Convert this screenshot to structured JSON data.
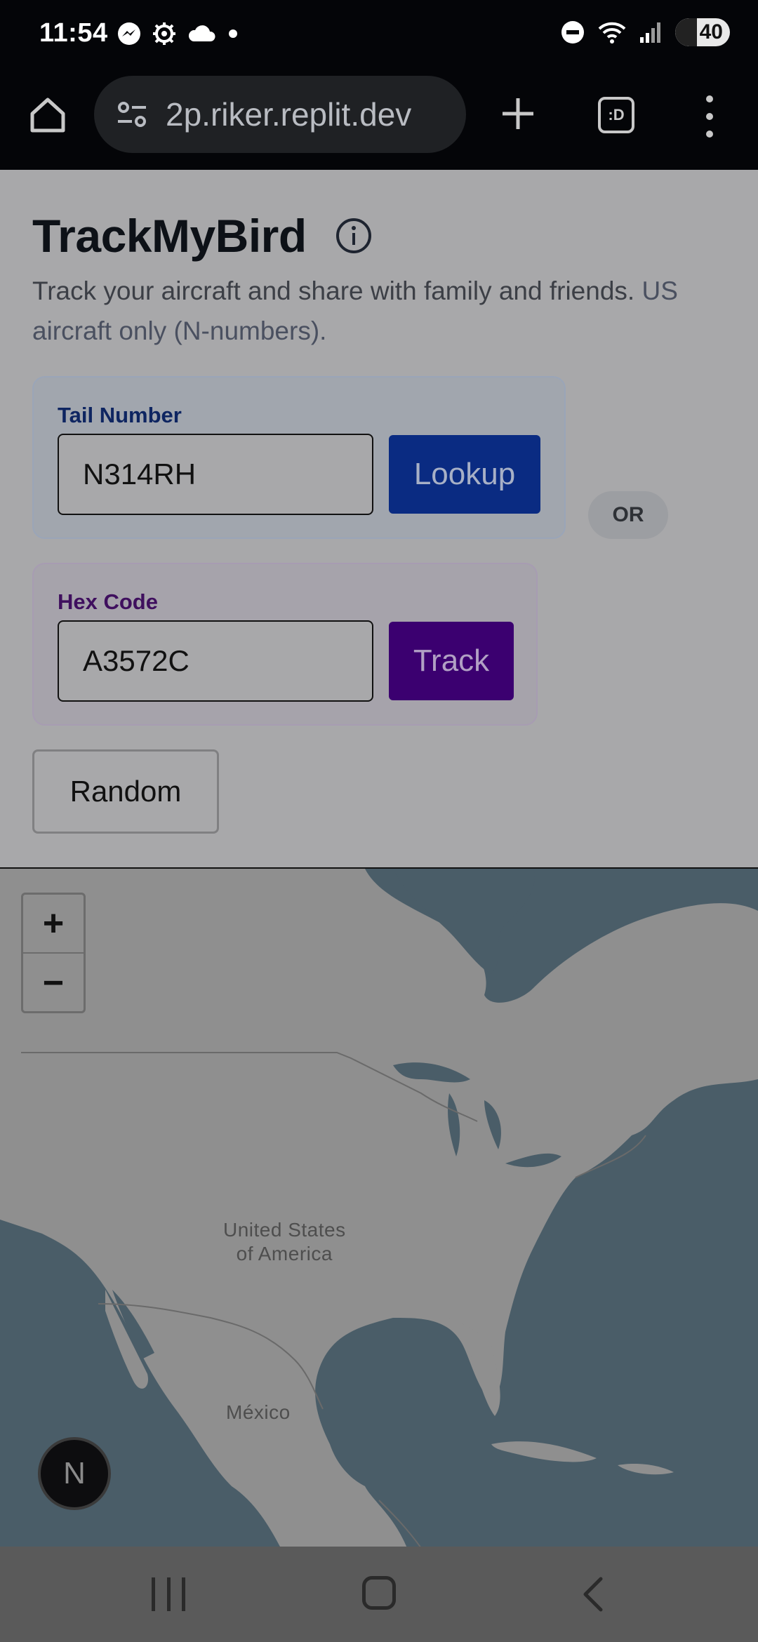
{
  "status_bar": {
    "time": "11:54",
    "battery": "40",
    "left_icons": [
      "messenger-icon",
      "settings-gear-icon",
      "cloud-icon",
      "dot-icon"
    ],
    "right_icons": [
      "do-not-disturb-icon",
      "wifi-icon",
      "signal-icon",
      "battery-icon"
    ]
  },
  "browser": {
    "url": "2p.riker.replit.dev",
    "tabs_label": ":D"
  },
  "page": {
    "title": "TrackMyBird",
    "subtitle": "Track your aircraft and share with family and friends.",
    "subtitle_note": "US aircraft only (N-numbers).",
    "tail": {
      "label": "Tail Number",
      "value": "N314RH",
      "button": "Lookup"
    },
    "or_label": "OR",
    "hex": {
      "label": "Hex Code",
      "value": "A3572C",
      "button": "Track"
    },
    "random_button": "Random"
  },
  "map": {
    "zoom_in": "+",
    "zoom_out": "−",
    "labels": {
      "usa": "United States\nof America",
      "mexico": "México"
    },
    "badge": "N"
  },
  "colors": {
    "lookup_button": "#0a2b82",
    "track_button": "#3b0070",
    "map_water": "#4a5d68",
    "map_land": "#8f8f8f"
  }
}
